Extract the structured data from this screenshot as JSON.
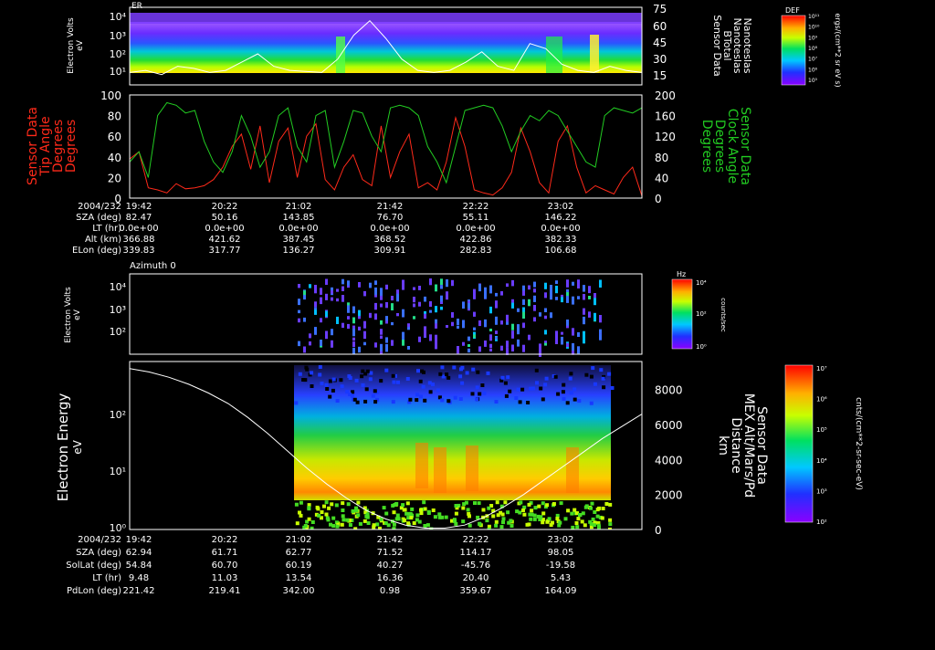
{
  "colors": {
    "background": "#000000",
    "axis": "#ffffff",
    "tip_angle": "#ff2a1a",
    "clock_angle": "#22cc22",
    "magnetic_field": "#ffffff"
  },
  "ticks_top": [
    "2004/232",
    "19:42",
    "20:22",
    "21:02",
    "21:42",
    "22:22",
    "23:02"
  ],
  "ticks_bottom": [
    "2004/232",
    "19:42",
    "20:22",
    "21:02",
    "21:42",
    "22:22",
    "23:02"
  ],
  "ephem_top": {
    "rows": [
      {
        "label": "SZA (deg)",
        "values": [
          "82.47",
          "50.16",
          "143.85",
          "76.70",
          "55.11",
          "146.22"
        ]
      },
      {
        "label": "LT (hr)",
        "values": [
          "0.0e+00",
          "0.0e+00",
          "0.0e+00",
          "0.0e+00",
          "0.0e+00",
          "0.0e+00"
        ]
      },
      {
        "label": "Alt (km)",
        "values": [
          "366.88",
          "421.62",
          "387.45",
          "368.52",
          "422.86",
          "382.33"
        ]
      },
      {
        "label": "ELon (deg)",
        "values": [
          "339.83",
          "317.77",
          "136.27",
          "309.91",
          "282.83",
          "106.68"
        ]
      }
    ]
  },
  "ephem_bottom": {
    "rows": [
      {
        "label": "SZA (deg)",
        "values": [
          "62.94",
          "61.71",
          "62.77",
          "71.52",
          "114.17",
          "98.05"
        ]
      },
      {
        "label": "SolLat (deg)",
        "values": [
          "54.84",
          "60.70",
          "60.19",
          "40.27",
          "-45.76",
          "-19.58"
        ]
      },
      {
        "label": "LT (hr)",
        "values": [
          "9.48",
          "11.03",
          "13.54",
          "16.36",
          "20.40",
          "5.43"
        ]
      },
      {
        "label": "PdLon (deg)",
        "values": [
          "221.42",
          "219.41",
          "342.00",
          "0.98",
          "359.67",
          "164.09"
        ]
      }
    ]
  },
  "chart_data": [
    {
      "type": "heatmap",
      "panel": "mgs-er-spectrogram",
      "title": "ER",
      "ylabel": "Electron Volts\neV",
      "y_scale": "log",
      "y_ticklabels": [
        "10⁴",
        "10³",
        "10²",
        "10¹"
      ],
      "right_axis_ticks": [
        "75",
        "60",
        "45",
        "30",
        "15"
      ],
      "right_labels": [
        "Sensor Data",
        "BTotal",
        "Nanoteslas",
        "Nanoteslas"
      ],
      "colorbar": {
        "title": "DEF",
        "units": "ergs/(cm**2 sr eV s)",
        "ticklabels": [
          "10⁵",
          "10⁶",
          "10⁷",
          "10⁸",
          "10⁹",
          "10¹⁰",
          "10¹¹"
        ]
      },
      "line_series": {
        "name": "BTotal",
        "values": [
          12,
          14,
          10,
          18,
          16,
          12,
          14,
          22,
          30,
          18,
          14,
          13,
          12,
          25,
          48,
          62,
          45,
          25,
          14,
          12,
          14,
          22,
          32,
          18,
          14,
          40,
          35,
          20,
          14,
          12,
          18,
          14,
          12
        ]
      }
    },
    {
      "type": "line",
      "panel": "mgs-angles",
      "left_axis": {
        "label": "Sensor Data Tip Angle Degrees Degrees",
        "lines": [
          "Sensor Data",
          "Tip Angle",
          "Degrees",
          "Degrees"
        ],
        "ylim": [
          0,
          100
        ],
        "ticks": [
          "0",
          "20",
          "40",
          "60",
          "80",
          "100"
        ]
      },
      "right_axis": {
        "label": "Sensor Data Clock Angle Degrees Degrees",
        "lines": [
          "Sensor Data",
          "Clock Angle",
          "Degrees",
          "Degrees"
        ],
        "ylim": [
          0,
          200
        ],
        "ticks": [
          "0",
          "40",
          "80",
          "120",
          "160",
          "200"
        ]
      },
      "series": [
        {
          "name": "Tip Angle",
          "axis": "left",
          "values": [
            38,
            45,
            10,
            8,
            5,
            14,
            9,
            10,
            12,
            18,
            30,
            50,
            62,
            28,
            70,
            15,
            55,
            68,
            20,
            60,
            72,
            18,
            8,
            30,
            42,
            18,
            12,
            70,
            20,
            45,
            62,
            10,
            15,
            8,
            35,
            78,
            50,
            8,
            5,
            3,
            10,
            25,
            68,
            45,
            15,
            5,
            55,
            70,
            30,
            5,
            12,
            8,
            4,
            20,
            30,
            2
          ]
        },
        {
          "name": "Clock Angle",
          "axis": "right",
          "values": [
            70,
            90,
            40,
            160,
            185,
            180,
            165,
            170,
            110,
            70,
            50,
            90,
            160,
            120,
            60,
            90,
            160,
            175,
            100,
            70,
            160,
            170,
            60,
            110,
            170,
            165,
            120,
            90,
            175,
            180,
            175,
            160,
            100,
            70,
            30,
            100,
            170,
            175,
            180,
            175,
            140,
            90,
            130,
            160,
            150,
            170,
            160,
            130,
            100,
            70,
            60,
            160,
            175,
            170,
            165,
            175
          ]
        }
      ]
    },
    {
      "type": "heatmap",
      "panel": "mex-azimuth",
      "title": "Azimuth 0",
      "ylabel": "Electron Volts\neV",
      "y_scale": "log",
      "y_ticklabels": [
        "10⁴",
        "10³",
        "10²"
      ],
      "colorbar": {
        "title": "Hz",
        "units": "counts/sec",
        "ticklabels": [
          "10⁴",
          "10²",
          "10⁰"
        ]
      }
    },
    {
      "type": "heatmap",
      "panel": "mex-electron-energy",
      "ylabel": "Electron Energy\neV",
      "y_scale": "log",
      "y_ticklabels": [
        "10²",
        "10¹",
        "10⁰"
      ],
      "right_axis": {
        "lines": [
          "Sensor Data",
          "MEX Alt/Mars/Pd",
          "Distance",
          "km"
        ],
        "ticks": [
          "8000",
          "6000",
          "4000",
          "2000",
          "0"
        ],
        "ylim": [
          0,
          9600
        ]
      },
      "colorbar": {
        "units": "cnts/(cm**2-sr-sec-eV)",
        "ticklabels": [
          "10⁷",
          "10⁶",
          "10⁵",
          "10⁴",
          "10³",
          "10²"
        ]
      },
      "line_series": {
        "name": "Distance",
        "values": [
          9200,
          9000,
          8700,
          8300,
          7800,
          7200,
          6400,
          5500,
          4500,
          3500,
          2600,
          1800,
          1100,
          600,
          250,
          80,
          80,
          250,
          700,
          1300,
          2000,
          2800,
          3600,
          4400,
          5200,
          5900,
          6600
        ]
      }
    }
  ]
}
